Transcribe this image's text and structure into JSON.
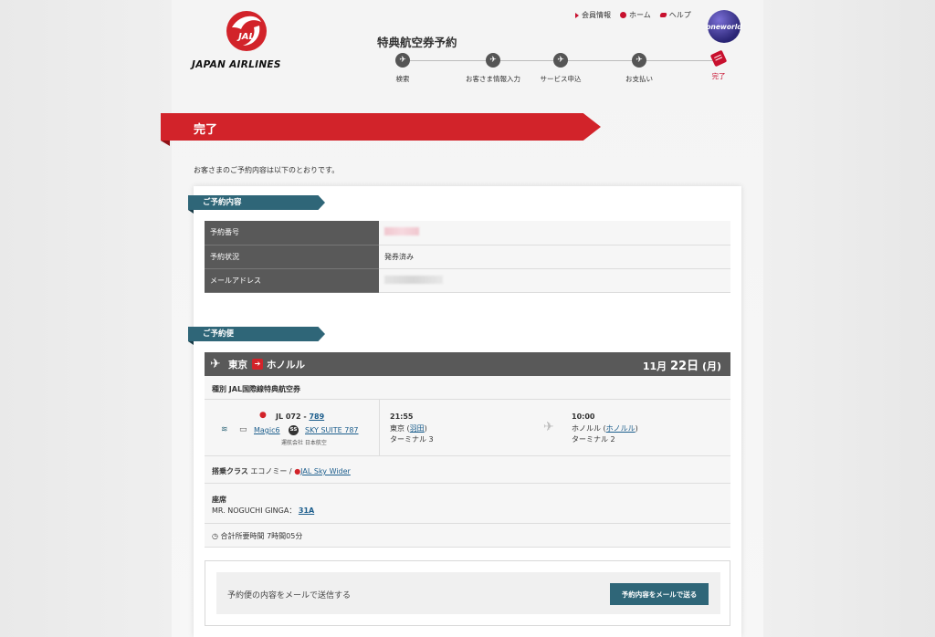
{
  "brand": {
    "logo_text": "JAPAN AIRLINES",
    "logo_mark": "JAL",
    "accent": "#d2232a",
    "teal": "#2f6678"
  },
  "page_heading": "特典航空券予約",
  "toplinks": [
    {
      "label": "会員情報",
      "icon": "triangle-icon"
    },
    {
      "label": "ホーム",
      "icon": "home-icon"
    },
    {
      "label": "ヘルプ",
      "icon": "help-icon"
    }
  ],
  "oneworld": "oneworld",
  "steps": [
    {
      "label": "検索",
      "icon": "plane-icon"
    },
    {
      "label": "お客さま情報入力",
      "icon": "plane-icon"
    },
    {
      "label": "サービス申込",
      "icon": "plane-icon"
    },
    {
      "label": "お支払い",
      "icon": "plane-icon"
    },
    {
      "label": "完了",
      "icon": "ticket-icon",
      "current": true
    }
  ],
  "banner": "完了",
  "intro": "お客さまのご予約内容は以下のとおりです。",
  "reservation": {
    "section_title": "ご予約内容",
    "rows": [
      {
        "key": "予約番号",
        "value": ""
      },
      {
        "key": "予約状況",
        "value": "発券済み"
      },
      {
        "key": "メールアドレス",
        "value": ""
      }
    ]
  },
  "flight": {
    "section_title": "ご予約便",
    "from": "東京",
    "to": "ホノルル",
    "date_month": "11月",
    "date_day": "22日",
    "date_weekday": "(月)",
    "fare_type_label": "種別",
    "fare_type": "JAL国際線特典航空券",
    "flight_no_prefix": "JL 072 - ",
    "flight_no_link": "789",
    "wifi_label": "Magic6",
    "seat_product": "SKY SUITE 787",
    "seat_badge": "SS",
    "operator": "運航会社 日本航空",
    "dep_time": "21:55",
    "dep_city": "東京 (",
    "dep_airport": "羽田",
    "dep_terminal": "ターミナル 3",
    "arr_time": "10:00",
    "arr_city": "ホノルル (",
    "arr_airport": "ホノルル",
    "arr_terminal": "ターミナル 2",
    "class_label": "搭乗クラス",
    "class_value": "エコノミー /",
    "class_link": "JAL Sky Wider",
    "seat_label": "座席",
    "passenger": "MR. NOGUCHI GINGA：",
    "seat": "31A",
    "duration": "合計所要時間 7時間05分"
  },
  "mail": {
    "text": "予約便の内容をメールで送信する",
    "button": "予約内容をメールで送る"
  }
}
